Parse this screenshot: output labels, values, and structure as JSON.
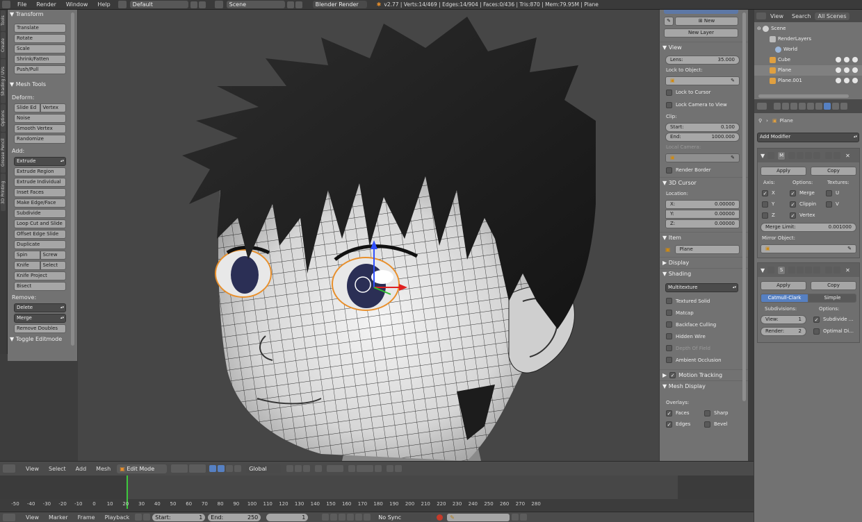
{
  "topbar": {
    "menus": [
      "File",
      "Render",
      "Window",
      "Help"
    ],
    "screen_layout": "Default",
    "scene": "Scene",
    "render_engine": "Blender Render",
    "stats": "v2.77 | Verts:14/469 | Edges:14/904 | Faces:0/436 | Tris:870 | Mem:79.95M | Plane"
  },
  "tabs": [
    "Tools",
    "Create",
    "Shading / UVs",
    "Options",
    "Grease Pencil",
    "3D Printing"
  ],
  "toolshelf": {
    "transform": {
      "title": "Transform",
      "buttons": [
        "Translate",
        "Rotate",
        "Scale",
        "Shrink/Fatten",
        "Push/Pull"
      ]
    },
    "mesh_tools": {
      "title": "Mesh Tools",
      "deform_label": "Deform:",
      "slide_edge": "Slide Ed",
      "vertex": "Vertex",
      "deform_buttons": [
        "Noise",
        "Smooth Vertex",
        "Randomize"
      ],
      "add_label": "Add:",
      "extrude": "Extrude",
      "add_buttons": [
        "Extrude Region",
        "Extrude Individual",
        "Inset Faces",
        "Make Edge/Face",
        "Subdivide",
        "Loop Cut and Slide",
        "Offset Edge Slide",
        "Duplicate"
      ],
      "spin": "Spin",
      "screw": "Screw",
      "knife": "Knife",
      "select": "Select",
      "knife_project": "Knife Project",
      "bisect": "Bisect",
      "remove_label": "Remove:",
      "delete": "Delete",
      "merge": "Merge",
      "remove_doubles": "Remove Doubles"
    },
    "toggle_editmode": "Toggle Editmode"
  },
  "npanel": {
    "new_btn": "New",
    "new_layer": "New Layer",
    "view": {
      "title": "View",
      "lens_label": "Lens:",
      "lens_value": "35.000",
      "lock_object": "Lock to Object:",
      "lock_cursor": "Lock to Cursor",
      "lock_camera": "Lock Camera to View",
      "clip_label": "Clip:",
      "clip_start_label": "Start:",
      "clip_start": "0.100",
      "clip_end_label": "End:",
      "clip_end": "1000.000",
      "local_camera": "Local Camera:",
      "render_border": "Render Border"
    },
    "cursor": {
      "title": "3D Cursor",
      "location": "Location:",
      "x_label": "X:",
      "x": "0.00000",
      "y_label": "Y:",
      "y": "0.00000",
      "z_label": "Z:",
      "z": "0.00000"
    },
    "item": {
      "title": "Item",
      "name": "Plane"
    },
    "display_title": "Display",
    "shading": {
      "title": "Shading",
      "mode": "Multitexture",
      "options": [
        "Textured Solid",
        "Matcap",
        "Backface Culling",
        "Hidden Wire",
        "Depth Of Field",
        "Ambient Occlusion"
      ]
    },
    "motion_tracking": "Motion Tracking",
    "mesh_display": {
      "title": "Mesh Display",
      "overlays": "Overlays:",
      "faces": "Faces",
      "sharp": "Sharp",
      "edges": "Edges",
      "bevel": "Bevel"
    }
  },
  "outliner": {
    "view": "View",
    "search": "Search",
    "all_scenes": "All Scenes",
    "items": [
      "Scene",
      "RenderLayers",
      "World",
      "Cube",
      "Plane",
      "Plane.001"
    ]
  },
  "properties": {
    "object_name": "Plane",
    "add_modifier": "Add Modifier",
    "mirror": {
      "short": "M",
      "apply": "Apply",
      "copy": "Copy",
      "axis": "Axis:",
      "options": "Options:",
      "textures": "Textures:",
      "x": "X",
      "y": "Y",
      "z": "Z",
      "merge": "Merge",
      "clipping": "Clippin",
      "vertex": "Vertex",
      "u": "U",
      "v": "V",
      "merge_limit_label": "Merge Limit:",
      "merge_limit": "0.001000",
      "mirror_object": "Mirror Object:"
    },
    "subsurf": {
      "short": "S",
      "apply": "Apply",
      "copy": "Copy",
      "catmull": "Catmull-Clark",
      "simple": "Simple",
      "subdivisions": "Subdivisions:",
      "options": "Options:",
      "view_label": "View:",
      "view": "1",
      "render_label": "Render:",
      "render": "2",
      "subdivide_uvs": "Subdivide ...",
      "optimal": "Optimal Di..."
    }
  },
  "header3d": {
    "view": "View",
    "select": "Select",
    "add": "Add",
    "mesh": "Mesh",
    "mode": "Edit Mode",
    "orientation": "Global"
  },
  "timeline": {
    "ticks": [
      "-50",
      "-40",
      "-30",
      "-20",
      "-10",
      "0",
      "10",
      "20",
      "30",
      "40",
      "50",
      "60",
      "70",
      "80",
      "90",
      "100",
      "110",
      "120",
      "130",
      "140",
      "150",
      "160",
      "170",
      "180",
      "190",
      "200",
      "210",
      "220",
      "230",
      "240",
      "250",
      "260",
      "270",
      "280"
    ],
    "current_frame_value": 1
  },
  "footer": {
    "view": "View",
    "marker": "Marker",
    "frame": "Frame",
    "playback": "Playback",
    "start_label": "Start:",
    "start": "1",
    "end_label": "End:",
    "end": "250",
    "current": "1",
    "sync": "No Sync"
  },
  "colors": {
    "panel_bg": "#727272",
    "viewport_bg": "#464646",
    "header_bg": "#4b4b4b",
    "selection_orange": "#e88f2b",
    "active_blue": "#5680c2",
    "axis_red": "#e02020",
    "axis_green": "#30c030",
    "axis_blue": "#3050ff",
    "frame_marker": "#3ec83e"
  }
}
